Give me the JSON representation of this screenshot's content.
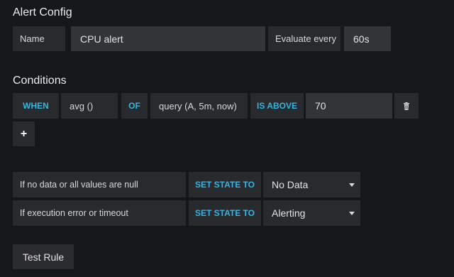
{
  "alert_config": {
    "heading": "Alert Config",
    "name_label": "Name",
    "name_value": "CPU alert",
    "evaluate_label": "Evaluate every",
    "evaluate_value": "60s"
  },
  "conditions": {
    "heading": "Conditions",
    "when_label": "WHEN",
    "reducer": "avg ()",
    "of_label": "OF",
    "query": "query (A, 5m, now)",
    "evaluator": "IS ABOVE",
    "threshold": "70",
    "add_label": "+",
    "icons": {
      "delete": "trash-icon"
    }
  },
  "no_data": {
    "label": "If no data or all values are null",
    "set_state_label": "SET STATE TO",
    "selected": "No Data"
  },
  "exec_error": {
    "label": "If execution error or timeout",
    "set_state_label": "SET STATE TO",
    "selected": "Alerting"
  },
  "test_button": "Test Rule",
  "colors": {
    "accent": "#33b5e5",
    "background": "#161719",
    "panel": "#292a2d"
  }
}
